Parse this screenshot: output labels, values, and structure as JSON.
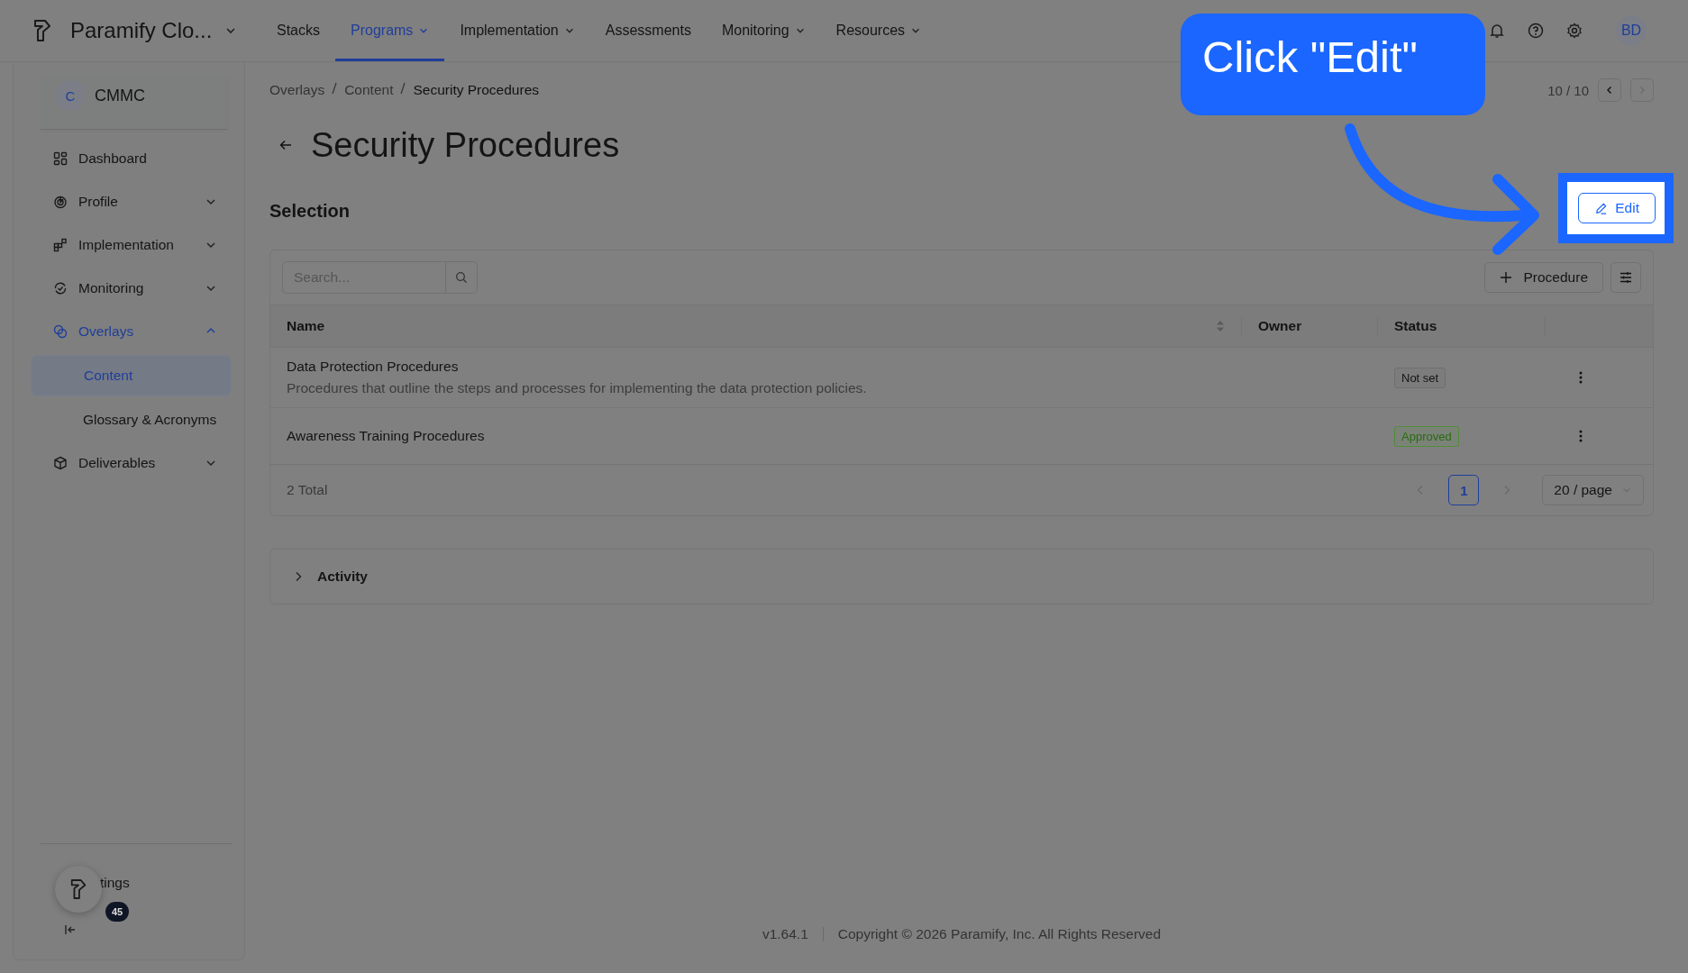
{
  "nav": {
    "brand": "Paramify Clo...",
    "items": [
      {
        "label": "Stacks",
        "dropdown": false,
        "selected": false
      },
      {
        "label": "Programs",
        "dropdown": true,
        "selected": true
      },
      {
        "label": "Implementation",
        "dropdown": true,
        "selected": false
      },
      {
        "label": "Assessments",
        "dropdown": false,
        "selected": false
      },
      {
        "label": "Monitoring",
        "dropdown": true,
        "selected": false
      },
      {
        "label": "Resources",
        "dropdown": true,
        "selected": false
      }
    ],
    "avatar": "BD"
  },
  "sidebar": {
    "program": {
      "initial": "C",
      "name": "CMMC"
    },
    "items": [
      {
        "label": "Dashboard",
        "selected": false
      },
      {
        "label": "Profile",
        "expanded": false,
        "selected": false
      },
      {
        "label": "Implementation",
        "expanded": false,
        "selected": false
      },
      {
        "label": "Monitoring",
        "expanded": false,
        "selected": false
      },
      {
        "label": "Overlays",
        "expanded": true,
        "selected": true,
        "children": [
          {
            "label": "Content",
            "selected": true
          },
          {
            "label": "Glossary & Acronyms",
            "selected": false
          }
        ]
      },
      {
        "label": "Deliverables",
        "expanded": false,
        "selected": false
      }
    ],
    "bottom_item": "tings",
    "helper_badge": "45"
  },
  "breadcrumb": [
    "Overlays",
    "Content",
    "Security Procedures"
  ],
  "pager": "10 / 10",
  "title": "Security Procedures",
  "section": "Selection",
  "edit_button": "Edit",
  "table": {
    "search": {
      "placeholder": "Search..."
    },
    "add_button": "Procedure",
    "columns": [
      "Name",
      "Owner",
      "Status"
    ],
    "rows": [
      {
        "name": "Data Protection Procedures",
        "description": "Procedures that outline the steps and processes for implementing the data protection policies.",
        "status": {
          "label": "Not set",
          "kind": "neutral"
        }
      },
      {
        "name": "Awareness Training Procedures",
        "status": {
          "label": "Approved",
          "kind": "approved"
        }
      }
    ],
    "total": "2 Total",
    "pages": [
      {
        "label": "1",
        "selected": true
      }
    ],
    "per_page": "20 / page"
  },
  "activity": {
    "label": "Activity",
    "expanded": false
  },
  "footer": {
    "version": "v1.64.1",
    "copyright": "Copyright © 2026 Paramify, Inc. All Rights Reserved"
  },
  "callout": {
    "text": "Click \"Edit\""
  }
}
